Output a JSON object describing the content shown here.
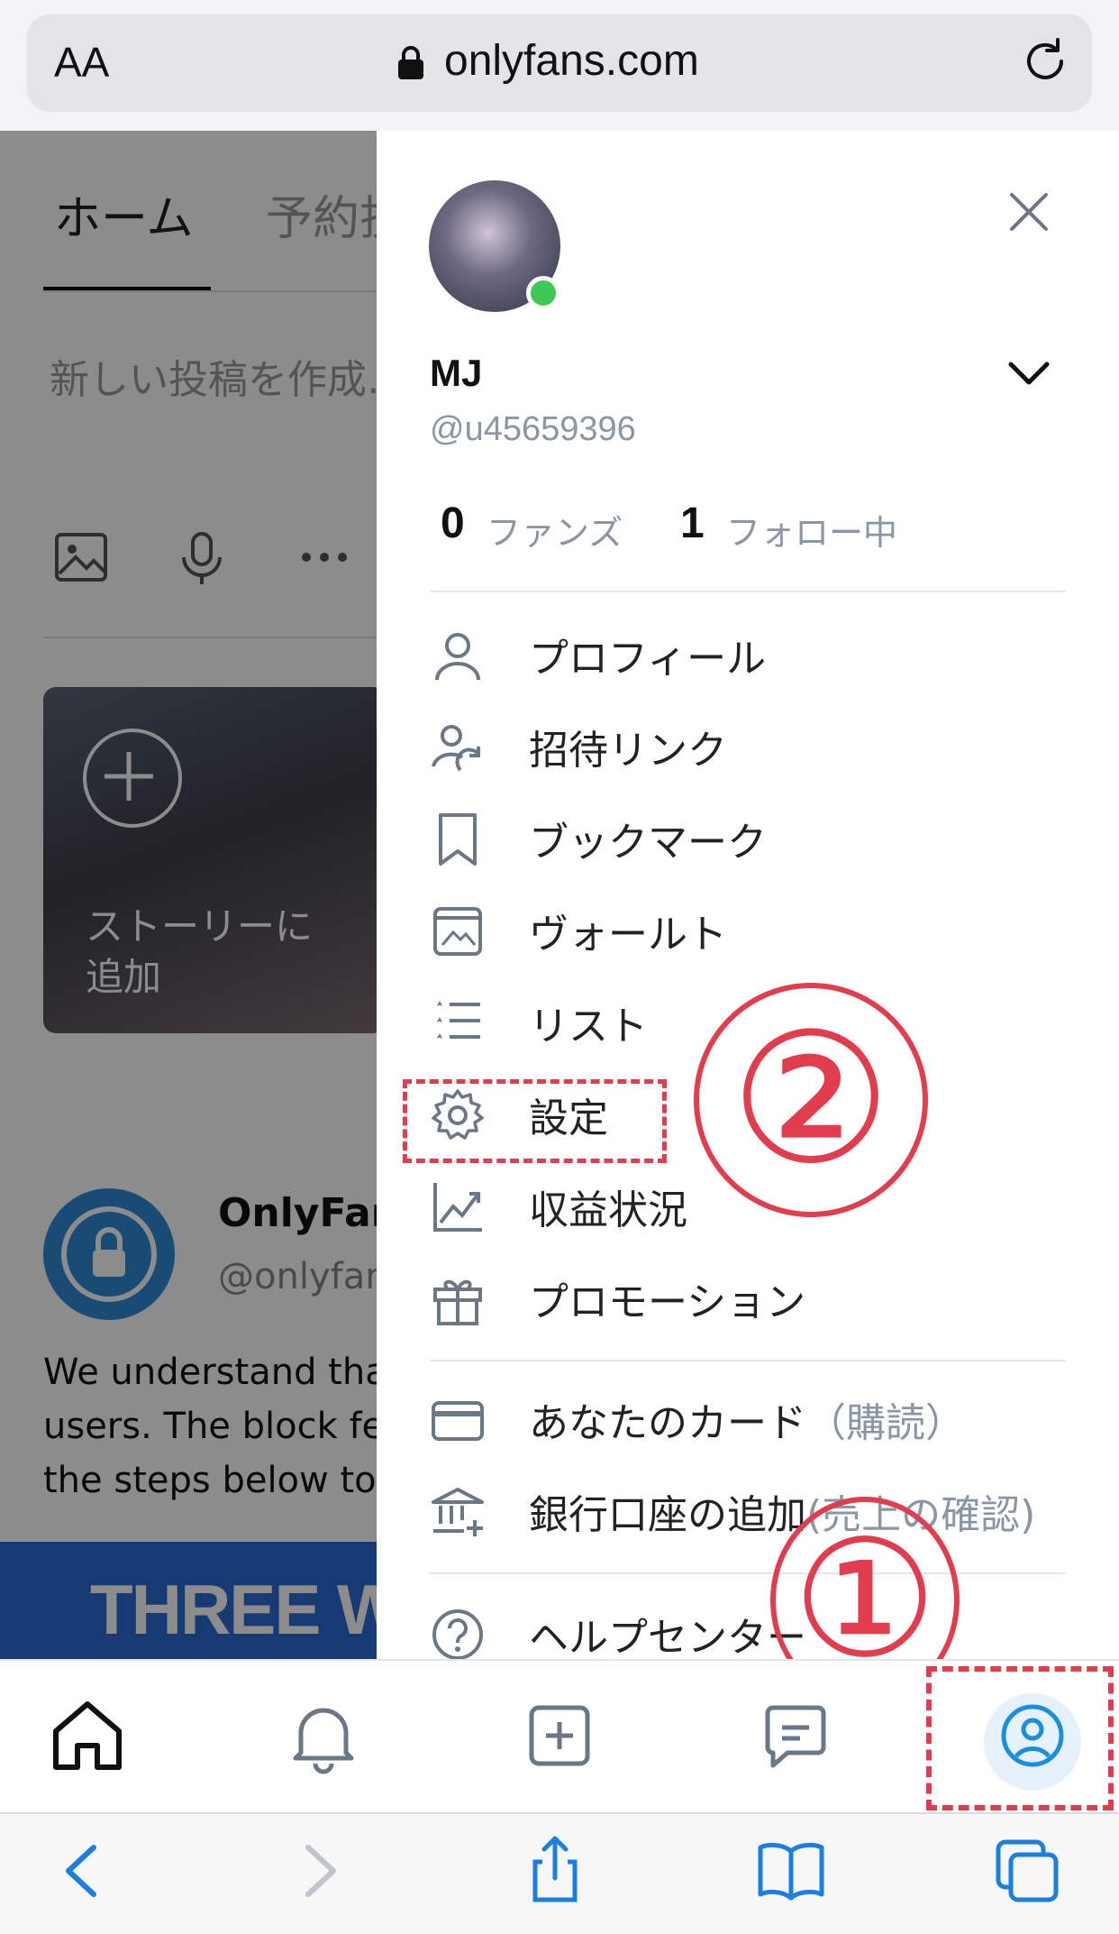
{
  "browser": {
    "text_size_label": "AA",
    "url": "onlyfans.com"
  },
  "background": {
    "tabs": [
      "ホーム",
      "予約投稿"
    ],
    "compose_placeholder": "新しい投稿を作成…",
    "story_label_line1": "ストーリーに",
    "story_label_line2": "追加",
    "post_author": "OnlyFans",
    "post_handle": "@onlyfans",
    "post_text_lines": [
      "We understand that",
      "users. The block fea",
      "the steps below to b"
    ],
    "banner_text": "THREE WAY"
  },
  "profile": {
    "name": "MJ",
    "handle": "@u45659396",
    "fans_count": "0",
    "fans_label": "ファンズ",
    "following_count": "1",
    "following_label": "フォロー中"
  },
  "menu": {
    "items": [
      {
        "label": "プロフィール",
        "icon": "person-icon"
      },
      {
        "label": "招待リンク",
        "icon": "invite-user-icon"
      },
      {
        "label": "ブックマーク",
        "icon": "bookmark-icon"
      },
      {
        "label": "ヴォールト",
        "icon": "vault-icon"
      },
      {
        "label": "リスト",
        "icon": "list-icon"
      },
      {
        "label": "設定",
        "icon": "gear-icon"
      },
      {
        "label": "収益状況",
        "icon": "chart-icon"
      },
      {
        "label": "プロモーション",
        "icon": "gift-icon"
      }
    ],
    "card": {
      "label": "あなたのカード",
      "sub": "（購読）",
      "icon": "card-icon"
    },
    "bank": {
      "label": "銀行口座の追加",
      "sub": "(売上の確認)",
      "icon": "bank-icon"
    },
    "help": {
      "label": "ヘルプセンター",
      "icon": "help-icon"
    }
  },
  "annotations": {
    "marker_settings": "②",
    "marker_profile": "①",
    "color": "#e23d4e"
  },
  "colors": {
    "online": "#3dc954",
    "accent": "#00aff0",
    "banner": "#2a6bd2"
  }
}
